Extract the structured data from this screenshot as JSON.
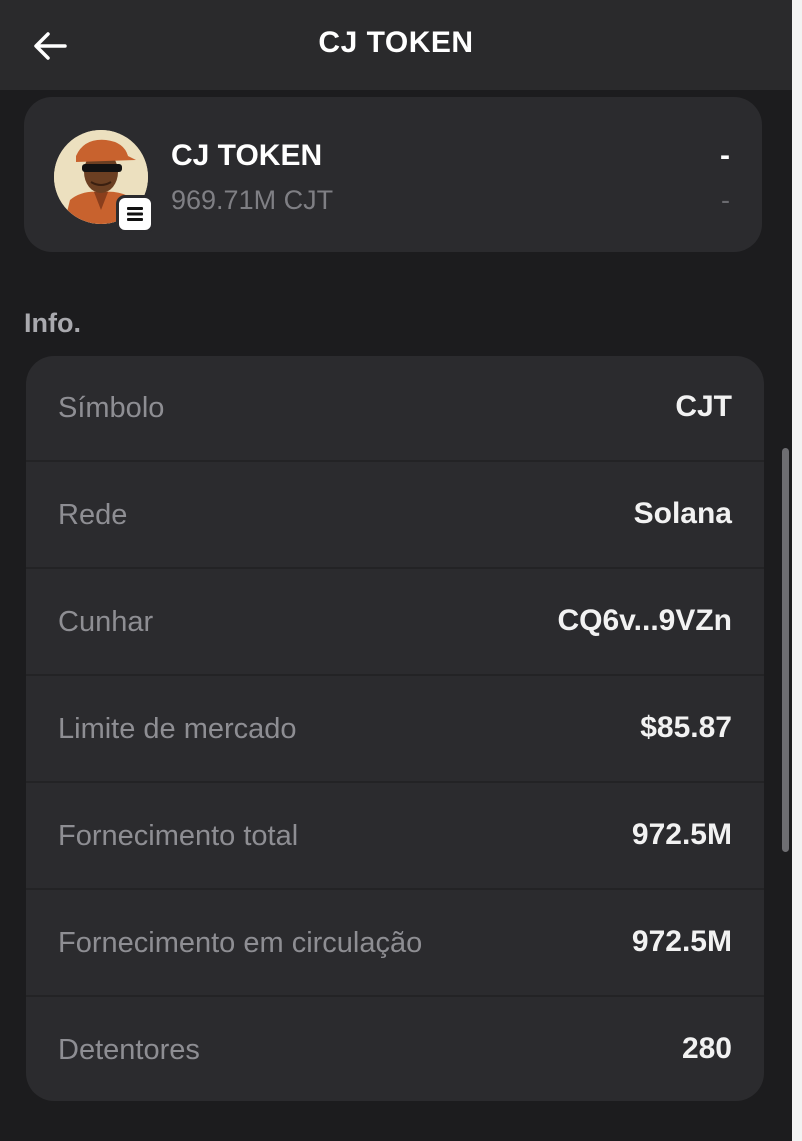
{
  "header": {
    "title": "CJ TOKEN",
    "back_icon": "arrow-left-icon"
  },
  "token": {
    "name": "CJ TOKEN",
    "balance": "969.71M CJT",
    "value": "-",
    "change": "-",
    "badge_icon": "menu-lines-icon"
  },
  "info": {
    "section_label": "Info.",
    "rows": [
      {
        "label": "Símbolo",
        "value": "CJT"
      },
      {
        "label": "Rede",
        "value": "Solana"
      },
      {
        "label": "Cunhar",
        "value": "CQ6v...9VZn"
      },
      {
        "label": "Limite de mercado",
        "value": "$85.87"
      },
      {
        "label": "Fornecimento total",
        "value": "972.5M"
      },
      {
        "label": "Fornecimento em circulação",
        "value": "972.5M"
      },
      {
        "label": "Detentores",
        "value": "280"
      }
    ]
  }
}
